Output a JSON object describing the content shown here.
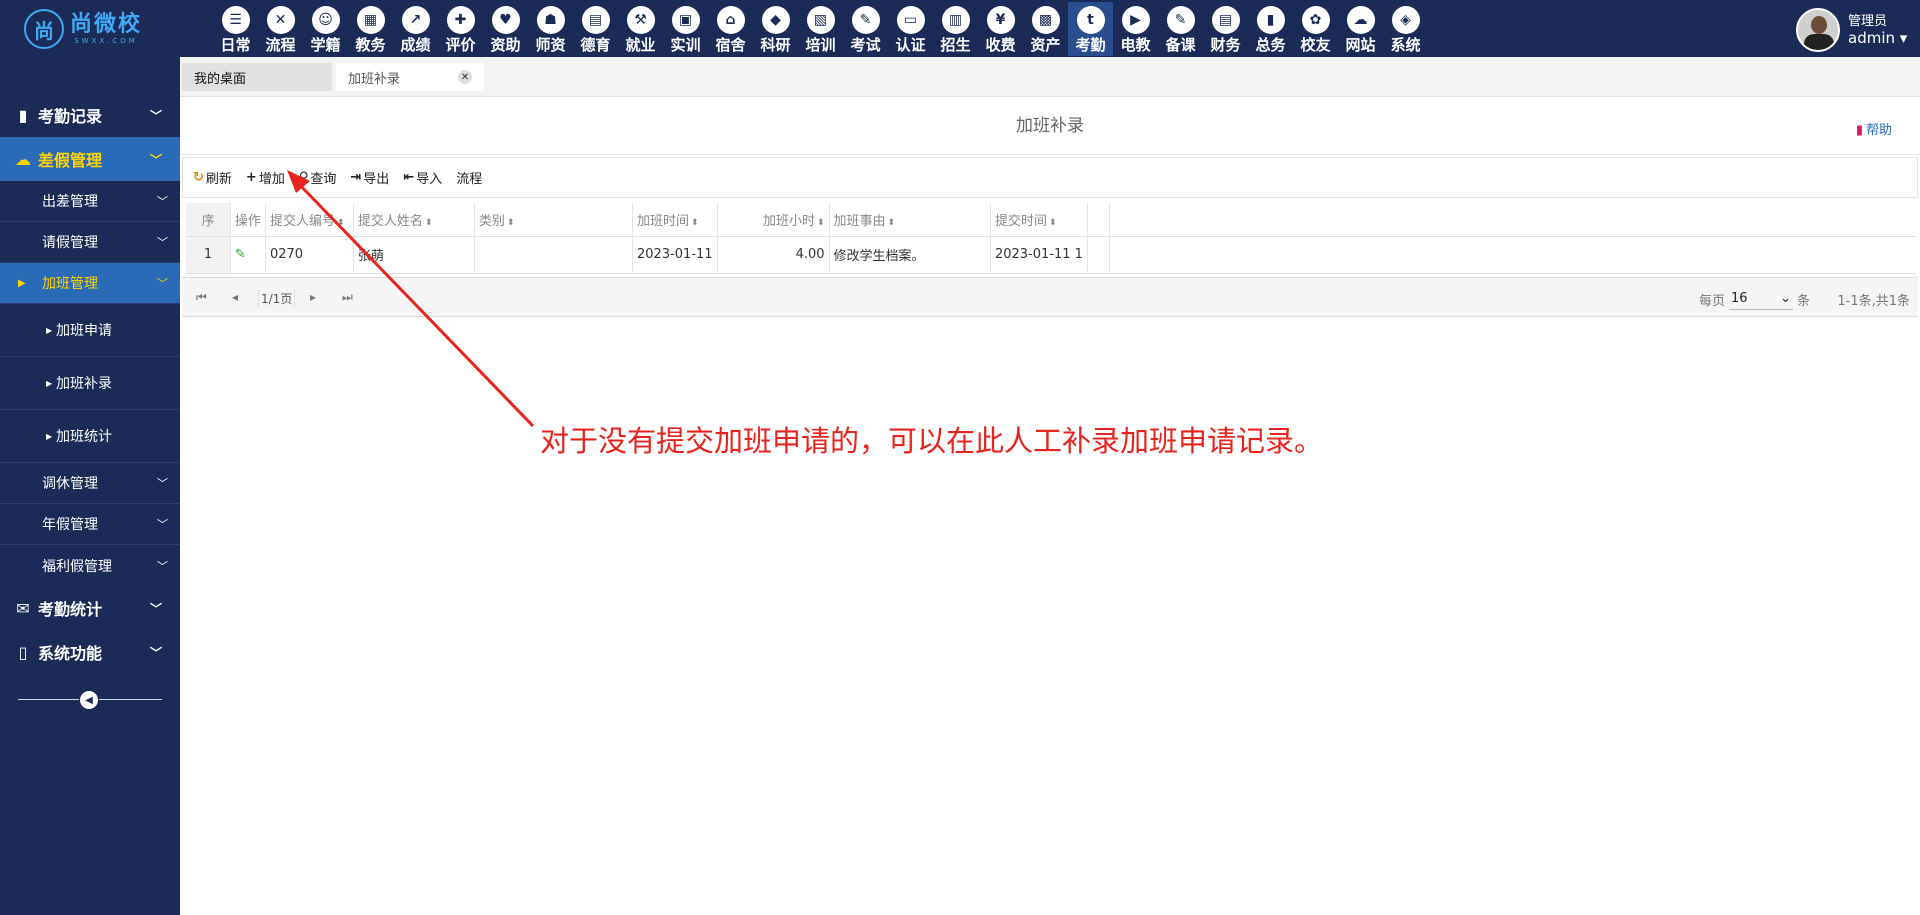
{
  "logo": {
    "mark": "尚",
    "name": "尚微校",
    "domain": "SWXX.COM"
  },
  "modules": [
    {
      "label": "日常",
      "glyph": "☰",
      "icon": "list-icon"
    },
    {
      "label": "流程",
      "glyph": "✕",
      "icon": "flow-icon"
    },
    {
      "label": "学籍",
      "glyph": "☺",
      "icon": "student-icon"
    },
    {
      "label": "教务",
      "glyph": "▦",
      "icon": "calendar-icon"
    },
    {
      "label": "成绩",
      "glyph": "↗",
      "icon": "chart-line-icon"
    },
    {
      "label": "评价",
      "glyph": "✚",
      "icon": "calendar-plus-icon"
    },
    {
      "label": "资助",
      "glyph": "♥",
      "icon": "aid-icon"
    },
    {
      "label": "师资",
      "glyph": "☗",
      "icon": "teacher-icon"
    },
    {
      "label": "德育",
      "glyph": "▤",
      "icon": "book-icon"
    },
    {
      "label": "就业",
      "glyph": "⚒",
      "icon": "hammer-icon"
    },
    {
      "label": "实训",
      "glyph": "▣",
      "icon": "training-icon"
    },
    {
      "label": "宿舍",
      "glyph": "⌂",
      "icon": "home-icon"
    },
    {
      "label": "科研",
      "glyph": "◆",
      "icon": "graduation-cap-icon"
    },
    {
      "label": "培训",
      "glyph": "▧",
      "icon": "image-icon"
    },
    {
      "label": "考试",
      "glyph": "✎",
      "icon": "key-icon"
    },
    {
      "label": "认证",
      "glyph": "▭",
      "icon": "monitor-icon"
    },
    {
      "label": "招生",
      "glyph": "▥",
      "icon": "bus-icon"
    },
    {
      "label": "收费",
      "glyph": "¥",
      "icon": "yen-icon"
    },
    {
      "label": "资产",
      "glyph": "▩",
      "icon": "asset-icon"
    },
    {
      "label": "考勤",
      "glyph": "t",
      "icon": "attendance-icon"
    },
    {
      "label": "电教",
      "glyph": "▶",
      "icon": "video-icon"
    },
    {
      "label": "备课",
      "glyph": "✎",
      "icon": "pen-icon"
    },
    {
      "label": "财务",
      "glyph": "▤",
      "icon": "newspaper-icon"
    },
    {
      "label": "总务",
      "glyph": "▮",
      "icon": "bar-chart-icon"
    },
    {
      "label": "校友",
      "glyph": "✿",
      "icon": "users-icon"
    },
    {
      "label": "网站",
      "glyph": "☁",
      "icon": "cloud-icon"
    },
    {
      "label": "系统",
      "glyph": "◈",
      "icon": "cube-icon"
    }
  ],
  "active_module": "考勤",
  "user": {
    "role": "管理员",
    "name": "admin"
  },
  "sidebar": {
    "attendance_records": "考勤记录",
    "leave_management": "差假管理",
    "business_trip": "出差管理",
    "leave_request": "请假管理",
    "overtime": "加班管理",
    "overtime_apply": "加班申请",
    "overtime_supplement": "加班补录",
    "overtime_stats": "加班统计",
    "comp_time": "调休管理",
    "annual_leave": "年假管理",
    "welfare_leave": "福利假管理",
    "attendance_stats": "考勤统计",
    "system_functions": "系统功能"
  },
  "tabs": {
    "desk": "我的桌面",
    "current": "加班补录",
    "close_glyph": "✕"
  },
  "page": {
    "title": "加班补录",
    "help": "帮助"
  },
  "toolbar": {
    "refresh": "刷新",
    "add": "增加",
    "query": "查询",
    "export": "导出",
    "import": "导入",
    "flow": "流程"
  },
  "table": {
    "headers": {
      "seq": "序",
      "op": "操作",
      "emp_no": "提交人编号",
      "emp_name": "提交人姓名",
      "category": "类别",
      "ot_time": "加班时间",
      "ot_hours": "加班小时",
      "reason": "加班事由",
      "submit_time": "提交时间"
    },
    "rows": [
      {
        "seq": "1",
        "emp_no": "0270",
        "emp_name": "张萌",
        "category": "",
        "ot_time": "2023-01-11",
        "ot_hours": "4.00",
        "reason": "修改学生档案。",
        "submit_time": "2023-01-11 1"
      }
    ]
  },
  "pager": {
    "page_info": "1/1页",
    "per_page_label": "每页",
    "per_page_value": "16",
    "per_page_unit": "条",
    "summary": "1-1条,共1条"
  },
  "annotation": "对于没有提交加班申请的，可以在此人工补录加班申请记录。",
  "colors": {
    "topbar": "#1b2a57",
    "sidebar_active": "#2a6bb8",
    "active_text": "#ffd400",
    "annotation": "#e8231d"
  }
}
